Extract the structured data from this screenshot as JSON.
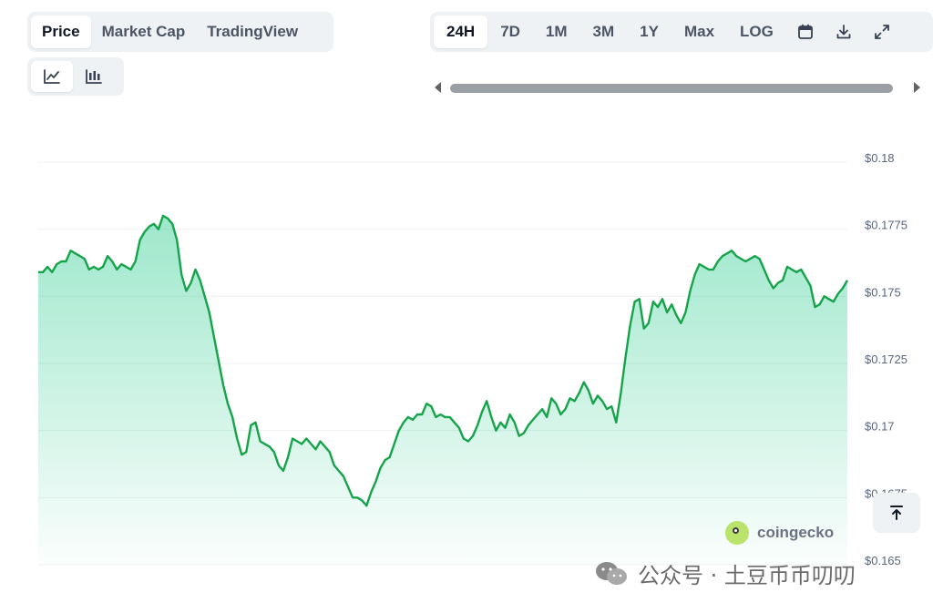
{
  "tabs": {
    "view": [
      {
        "label": "Price",
        "active": true
      },
      {
        "label": "Market Cap",
        "active": false
      },
      {
        "label": "TradingView",
        "active": false
      }
    ],
    "range": [
      {
        "label": "24H",
        "active": true
      },
      {
        "label": "7D",
        "active": false
      },
      {
        "label": "1M",
        "active": false
      },
      {
        "label": "3M",
        "active": false
      },
      {
        "label": "1Y",
        "active": false
      },
      {
        "label": "Max",
        "active": false
      },
      {
        "label": "LOG",
        "active": false
      }
    ]
  },
  "toolbar_icons": [
    "calendar-icon",
    "download-icon",
    "expand-icon"
  ],
  "chart_type_icons": [
    "line-chart-icon",
    "candlestick-icon"
  ],
  "brand": "coingecko",
  "watermark": "公众号 · 土豆币币叨叨",
  "colors": {
    "line": "#16a34a",
    "fill": "#16c784",
    "accent_tab_bg": "#eff2f5"
  },
  "chart_data": {
    "type": "area",
    "title": "",
    "xlabel": "",
    "ylabel": "",
    "ylim": [
      0.165,
      0.18
    ],
    "yticks": [
      0.18,
      0.1775,
      0.175,
      0.1725,
      0.17,
      0.1675,
      0.165
    ],
    "ytick_labels": [
      "$0.18",
      "$0.1775",
      "$0.175",
      "$0.1725",
      "$0.17",
      "$0.1675",
      "$0.165"
    ],
    "grid": true,
    "legend": "none",
    "series": [
      {
        "values": [
          0.1759,
          0.1759,
          0.1761,
          0.1759,
          0.1762,
          0.1763,
          0.1763,
          0.1767,
          0.1766,
          0.1765,
          0.1764,
          0.176,
          0.1761,
          0.176,
          0.1761,
          0.1765,
          0.1763,
          0.176,
          0.1762,
          0.1761,
          0.176,
          0.1763,
          0.1771,
          0.1774,
          0.1776,
          0.1777,
          0.1775,
          0.178,
          0.1779,
          0.1777,
          0.1771,
          0.1758,
          0.1752,
          0.1755,
          0.176,
          0.1756,
          0.175,
          0.1744,
          0.1735,
          0.1726,
          0.1717,
          0.171,
          0.1705,
          0.1697,
          0.1691,
          0.1692,
          0.1702,
          0.1703,
          0.1696,
          0.1695,
          0.1694,
          0.1692,
          0.1687,
          0.1685,
          0.169,
          0.1697,
          0.1696,
          0.1695,
          0.1697,
          0.1695,
          0.1693,
          0.1696,
          0.1694,
          0.1692,
          0.1687,
          0.1685,
          0.1683,
          0.1679,
          0.1675,
          0.1675,
          0.1674,
          0.1672,
          0.1677,
          0.1681,
          0.1686,
          0.1689,
          0.169,
          0.1695,
          0.17,
          0.1703,
          0.1705,
          0.1704,
          0.1706,
          0.1706,
          0.171,
          0.1709,
          0.1705,
          0.1706,
          0.1705,
          0.1705,
          0.1703,
          0.1701,
          0.1697,
          0.1696,
          0.1698,
          0.1702,
          0.1707,
          0.1711,
          0.1705,
          0.17,
          0.1703,
          0.1701,
          0.1706,
          0.1703,
          0.1698,
          0.1699,
          0.1702,
          0.1704,
          0.1706,
          0.1708,
          0.1705,
          0.1712,
          0.171,
          0.1706,
          0.1708,
          0.1712,
          0.1711,
          0.1714,
          0.1718,
          0.1715,
          0.171,
          0.1713,
          0.1711,
          0.1708,
          0.1709,
          0.1703,
          0.1714,
          0.1727,
          0.1739,
          0.1748,
          0.1749,
          0.1738,
          0.174,
          0.1748,
          0.1746,
          0.1749,
          0.1744,
          0.1747,
          0.1743,
          0.174,
          0.1744,
          0.1752,
          0.1758,
          0.1762,
          0.1761,
          0.176,
          0.176,
          0.1763,
          0.1765,
          0.1766,
          0.1767,
          0.1765,
          0.1764,
          0.1763,
          0.1764,
          0.1765,
          0.1764,
          0.176,
          0.1756,
          0.1753,
          0.1755,
          0.1756,
          0.1761,
          0.176,
          0.1759,
          0.176,
          0.1757,
          0.1754,
          0.1746,
          0.1747,
          0.175,
          0.1749,
          0.1748,
          0.1751,
          0.1753,
          0.1756
        ]
      }
    ]
  }
}
